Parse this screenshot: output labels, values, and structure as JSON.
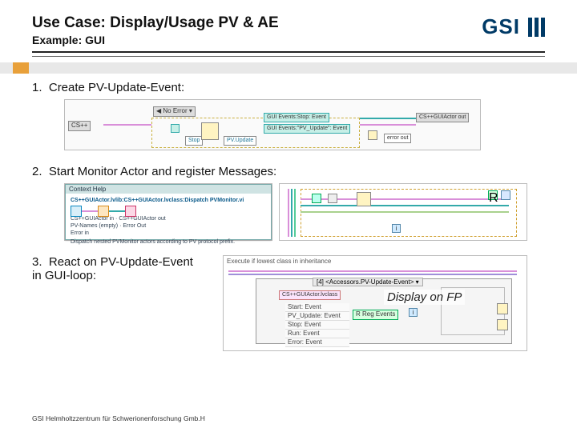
{
  "header": {
    "title": "Use Case: Display/Usage PV & AE",
    "subtitle": "Example: GUI",
    "logo_text": "GSI"
  },
  "steps": [
    {
      "num": "1.",
      "text": "Create PV-Update-Event:"
    },
    {
      "num": "2.",
      "text": "Start Monitor Actor and register Messages:"
    },
    {
      "num": "3.",
      "text": "React on PV-Update-Event\nin GUI-loop:"
    }
  ],
  "diagram1": {
    "error_in": "No Error",
    "stop": "Stop",
    "pv_update": "PV.Update",
    "evt1": "GUI Events:Stop: Event",
    "evt2": "GUI Events:\"PV_Update\": Event",
    "error_out": "error out",
    "right_label": "CS++GUIActor out",
    "left_label": "CS++"
  },
  "diagram2": {
    "help_title": "Context Help",
    "help_line1": "CS++GUIActor.lvlib:CS++GUIActor.lvclass:Dispatch PVMonitor.vi",
    "help_line2": "CS++GUIActor in",
    "help_line3": "PV-Names (empty)",
    "help_line4": "Error in",
    "help_line5": "CS++GUIActor out",
    "help_line6": "Error Out",
    "help_line7": "Dispatch nested PVMonitor actors according to PV protocol prefix.",
    "icon_r": "R",
    "icon_i": "i"
  },
  "diagram3": {
    "top_caption": "Execute if lowest class in inheritance",
    "event_header": "[4] <Accessors.PV-Update-Event> ▾",
    "menu": [
      "Start: Event",
      "PV_Update: Event",
      "Stop: Event",
      "Run: Event",
      "Error: Event"
    ],
    "class_box": "CS++GUIActor.lvclass",
    "reg_label": "R Reg Events",
    "overlay": "Display on FP"
  },
  "footer": "GSI Helmholtzzentrum für Schwerionenforschung Gmb.H"
}
